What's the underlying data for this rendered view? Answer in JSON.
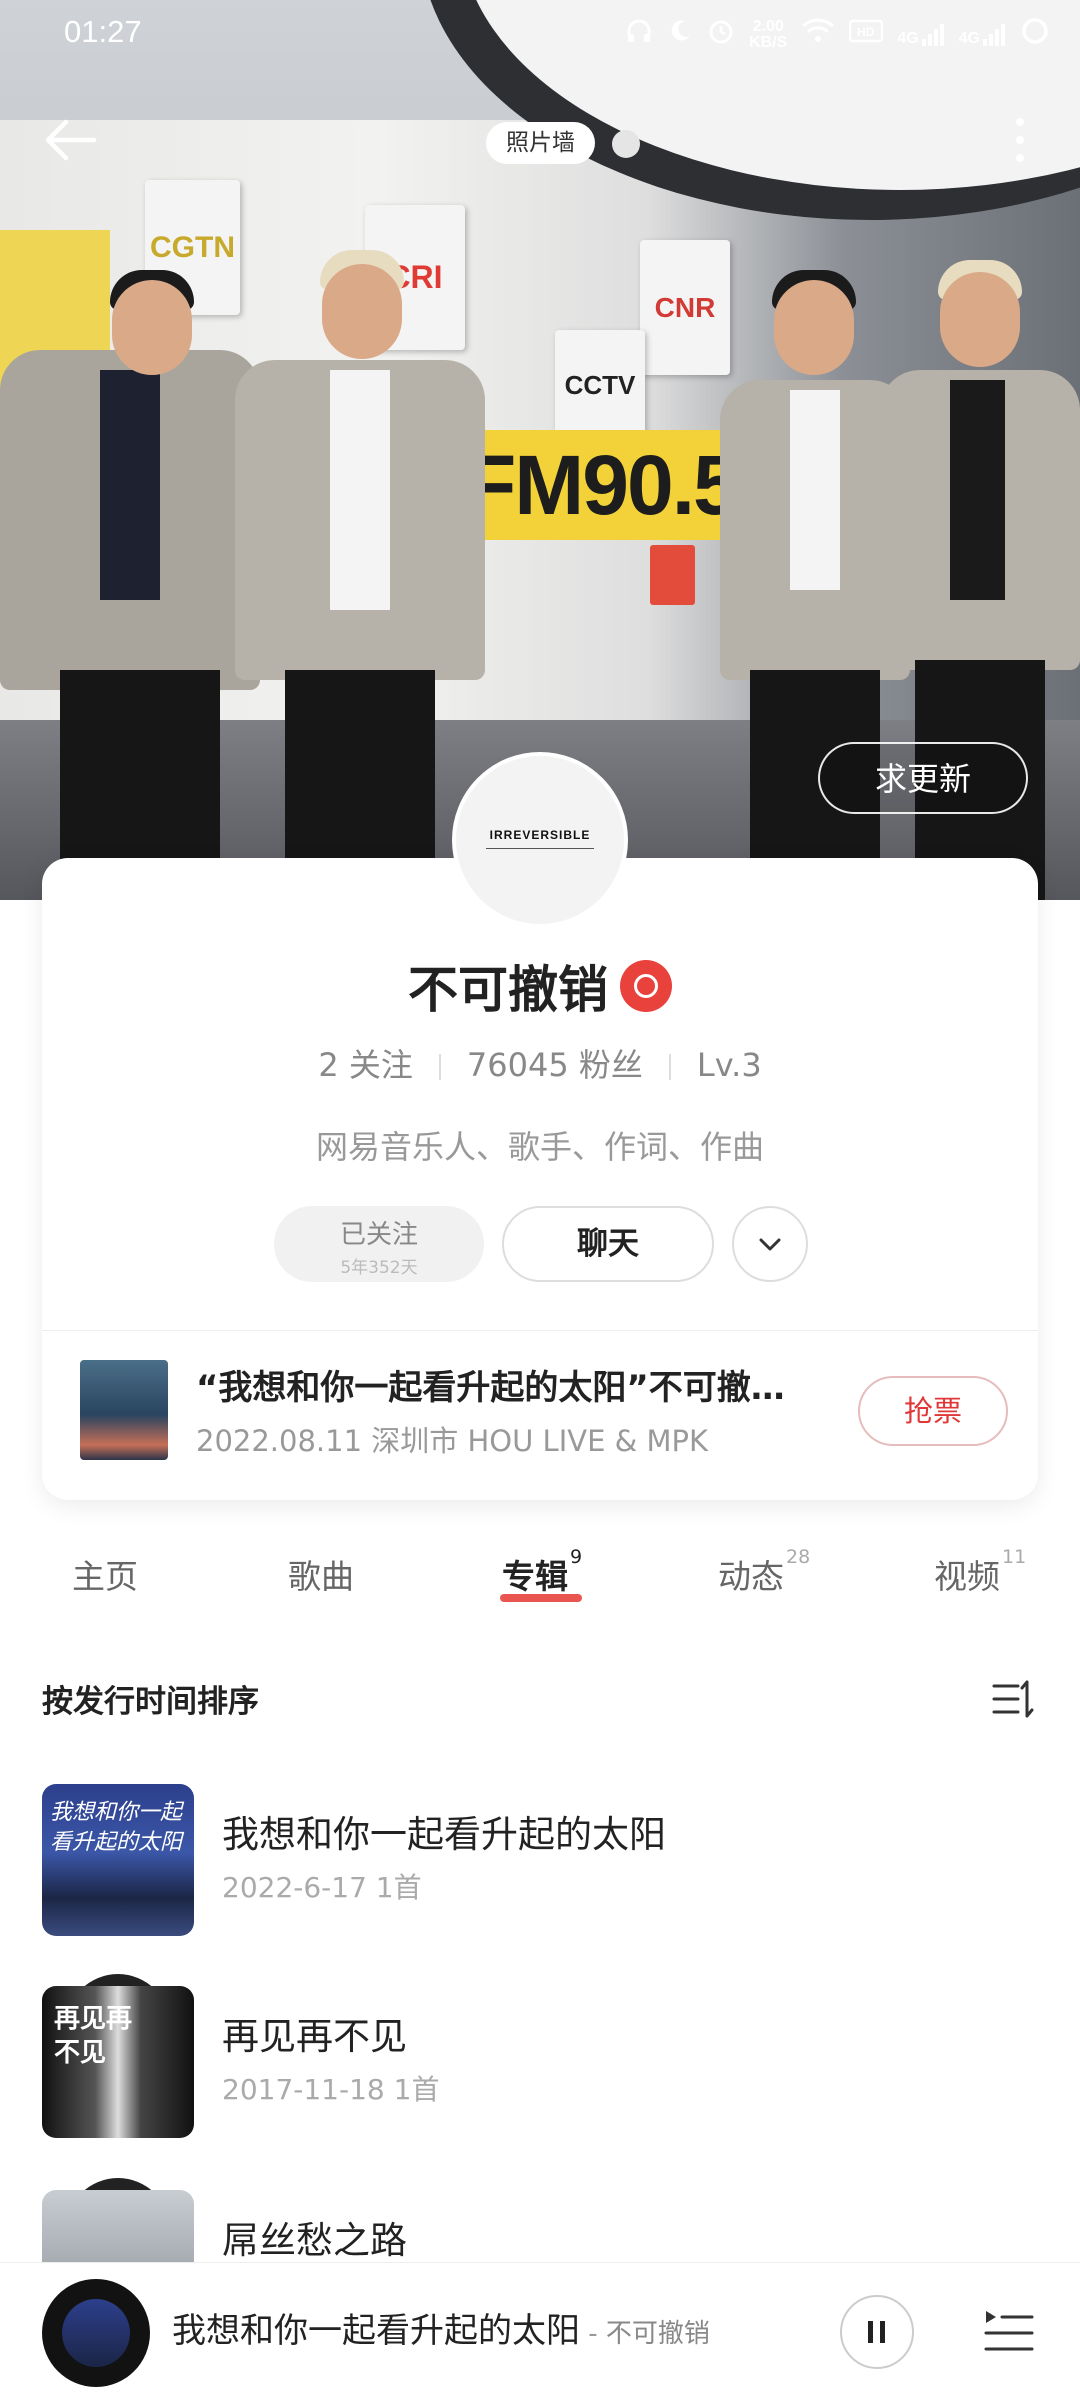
{
  "status_bar": {
    "time": "01:27",
    "net_speed": "2.00\nKB/S",
    "network_1": "4G",
    "network_2": "4G"
  },
  "header": {
    "photo_wall_label": "照片墙",
    "request_update_label": "求更新"
  },
  "profile": {
    "avatar_text": "IRREVERSIBLE",
    "name": "不可撤销",
    "following": "2 关注",
    "followers": "76045 粉丝",
    "level": "Lv.3",
    "tags": "网易音乐人、歌手、作词、作曲",
    "followed_label": "已关注",
    "followed_duration": "5年352天",
    "chat_label": "聊天"
  },
  "concert": {
    "title": "“我想和你一起看升起的太阳”不可撤销巡演",
    "info": "2022.08.11 深圳市 HOU LIVE & MPK",
    "ticket_label": "抢票"
  },
  "tabs": [
    {
      "label": "主页",
      "count": ""
    },
    {
      "label": "歌曲",
      "count": ""
    },
    {
      "label": "专辑",
      "count": "9"
    },
    {
      "label": "动态",
      "count": "28"
    },
    {
      "label": "视频",
      "count": "11"
    }
  ],
  "albums_section": {
    "sort_label": "按发行时间排序",
    "items": [
      {
        "title": "我想和你一起看升起的太阳",
        "meta": "2022-6-17 1首",
        "cover_text": "我想和你一起看升起的太阳"
      },
      {
        "title": "再见再不见",
        "meta": "2017-11-18 1首",
        "cover_text": "再见再不见"
      },
      {
        "title": "屌丝愁之路",
        "meta": "",
        "cover_text": ""
      }
    ]
  },
  "player": {
    "song": "我想和你一起看升起的太阳",
    "separator": " - ",
    "artist": "不可撤销"
  },
  "colors": {
    "accent": "#e9423d",
    "text_primary": "#222222",
    "text_secondary": "#999999"
  }
}
